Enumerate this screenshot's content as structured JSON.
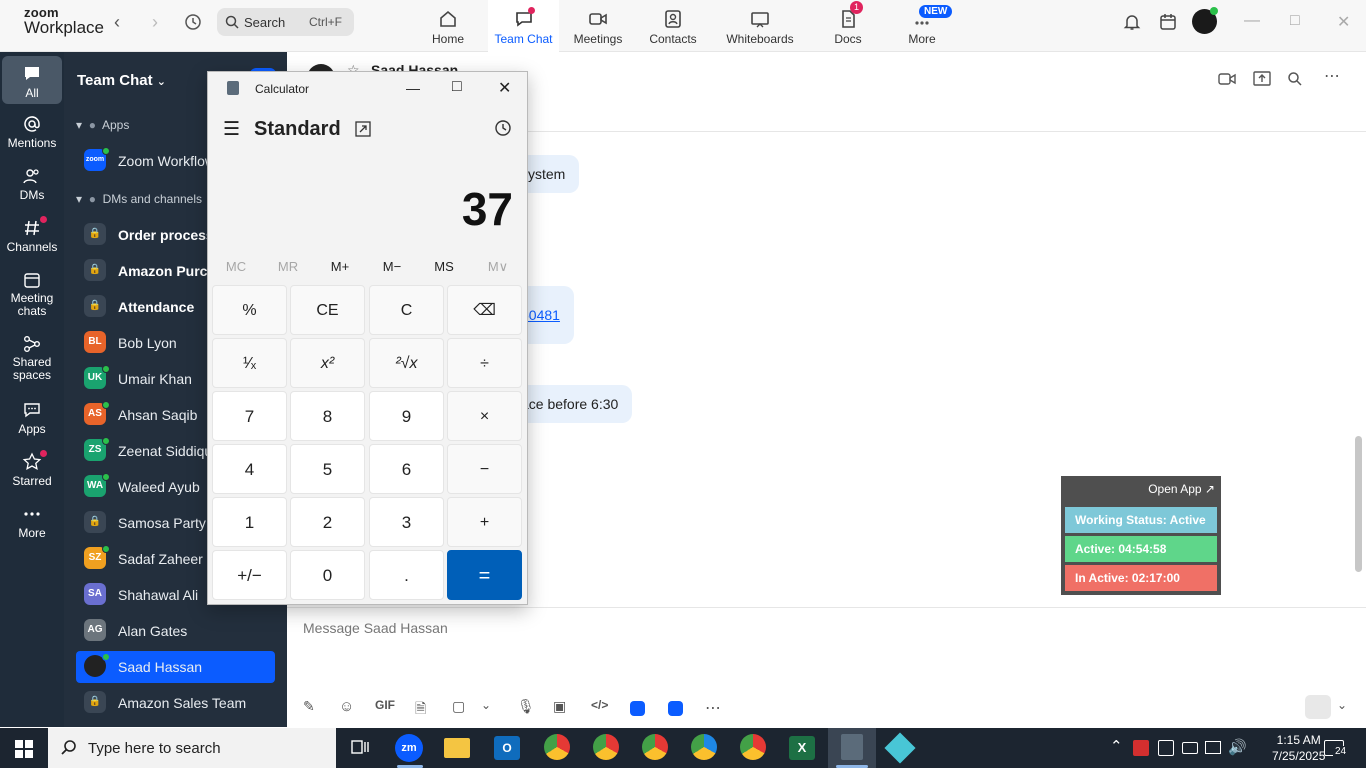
{
  "app": {
    "logo_line1": "zoom",
    "logo_line2": "Workplace"
  },
  "topbar": {
    "search_placeholder": "Search",
    "search_shortcut": "Ctrl+F",
    "tabs": [
      {
        "label": "Home",
        "icon": "home-icon"
      },
      {
        "label": "Team Chat",
        "icon": "chat-icon",
        "active": true
      },
      {
        "label": "Meetings",
        "icon": "video-icon"
      },
      {
        "label": "Contacts",
        "icon": "contacts-icon"
      },
      {
        "label": "Whiteboards",
        "icon": "whiteboard-icon"
      },
      {
        "label": "Docs",
        "icon": "docs-icon",
        "badge": "1"
      },
      {
        "label": "More",
        "icon": "more-icon",
        "new_badge": "NEW"
      }
    ]
  },
  "rail": {
    "items": [
      {
        "label": "All",
        "icon": "chat-bubble-icon"
      },
      {
        "label": "Mentions",
        "icon": "at-icon"
      },
      {
        "label": "DMs",
        "icon": "people-icon"
      },
      {
        "label": "Channels",
        "icon": "hash-icon"
      },
      {
        "label": "Meeting chats",
        "icon": "calendar-icon"
      },
      {
        "label": "Shared spaces",
        "icon": "share-icon"
      },
      {
        "label": "Apps",
        "icon": "apps-icon"
      },
      {
        "label": "Starred",
        "icon": "star-icon"
      },
      {
        "label": "More",
        "icon": "ellipsis-icon"
      }
    ]
  },
  "side": {
    "title": "Team Chat",
    "section_apps": "Apps",
    "app_item": "Zoom Workflows",
    "section_dms": "DMs and channels",
    "rows": [
      {
        "label": "Order processing",
        "initials": "",
        "bold": true
      },
      {
        "label": "Amazon Purchase",
        "initials": "",
        "bold": true
      },
      {
        "label": "Attendance",
        "initials": "",
        "bold": true
      },
      {
        "label": "Bob Lyon",
        "initials": "BL",
        "color": "#e8642a"
      },
      {
        "label": "Umair Khan",
        "initials": "UK",
        "color": "#1aa36f"
      },
      {
        "label": "Ahsan Saqib",
        "initials": "AS",
        "color": "#e8642a"
      },
      {
        "label": "Zeenat Siddiqui",
        "initials": "ZS",
        "color": "#1aa36f"
      },
      {
        "label": "Waleed Ayub",
        "initials": "WA",
        "color": "#1aa36f"
      },
      {
        "label": "Samosa Party",
        "initials": ""
      },
      {
        "label": "Sadaf Zaheer",
        "initials": "SZ",
        "color": "#f0a020"
      },
      {
        "label": "Shahawal Ali",
        "initials": "SA",
        "color": "#6a6fd0"
      },
      {
        "label": "Alan Gates",
        "initials": "AG",
        "color": "#6c757d"
      },
      {
        "label": "Saad Hassan",
        "initials": "",
        "selected": true
      },
      {
        "label": "Amazon Sales Team",
        "initials": ""
      }
    ]
  },
  "chat": {
    "contact": "Saad Hassan",
    "messages": [
      {
        "text": "system"
      },
      {
        "text": "50481"
      },
      {
        "text": "ace before 6:30"
      }
    ],
    "compose_placeholder": "Message Saad Hassan",
    "gif_label": "GIF"
  },
  "widget": {
    "open_app": "Open App ↗",
    "working_status": "Working Status: Active",
    "active": "Active: 04:54:58",
    "inactive": "In Active: 02:17:00",
    "colors": {
      "status": "#7ec8d8",
      "active": "#5fd68a",
      "inactive": "#f07066"
    }
  },
  "calculator": {
    "title": "Calculator",
    "mode": "Standard",
    "display": "37",
    "memory": [
      "MC",
      "MR",
      "M+",
      "M−",
      "MS",
      "M∨"
    ],
    "keys": [
      [
        "%",
        "CE",
        "C",
        "⌫"
      ],
      [
        "¹⁄ₓ",
        "x²",
        "²√x",
        "÷"
      ],
      [
        "7",
        "8",
        "9",
        "×"
      ],
      [
        "4",
        "5",
        "6",
        "−"
      ],
      [
        "1",
        "2",
        "3",
        "+"
      ],
      [
        "+/−",
        "0",
        ".",
        "="
      ]
    ]
  },
  "taskbar": {
    "search_placeholder": "Type here to search",
    "time": "1:15 AM",
    "date": "7/25/2025",
    "notifications": "24"
  }
}
